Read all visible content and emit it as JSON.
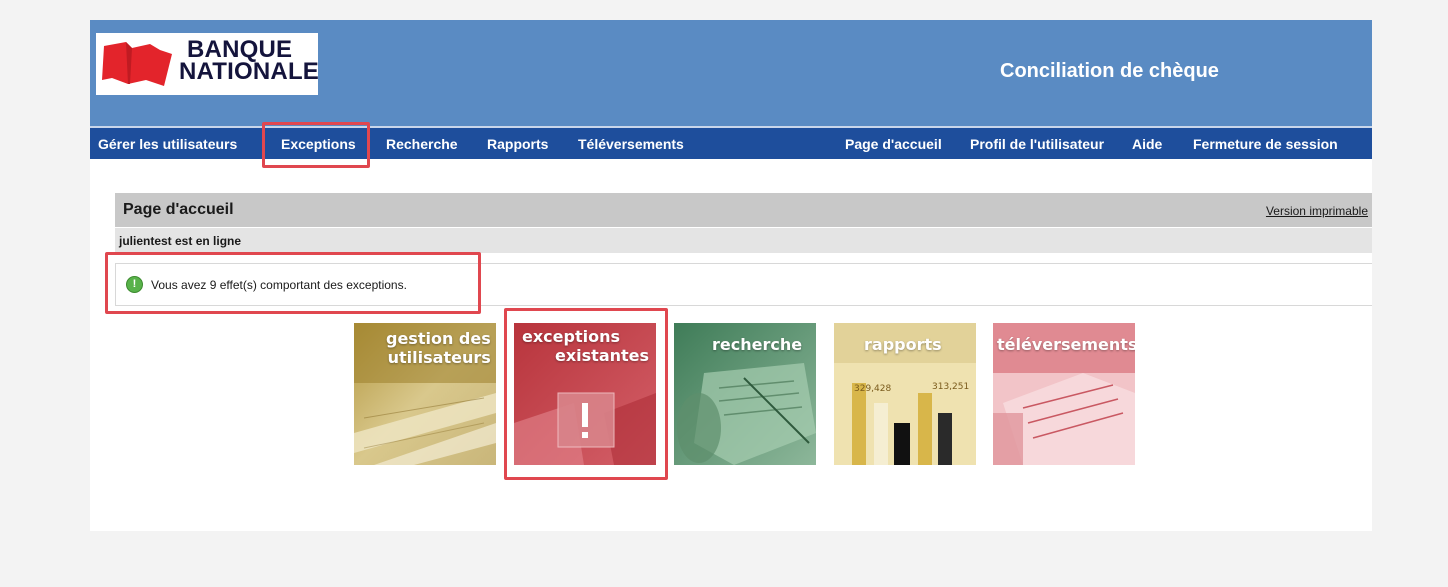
{
  "header": {
    "logo_line1": "BANQUE",
    "logo_line2": "NATIONALE",
    "app_title": "Conciliation de chèque"
  },
  "nav": {
    "left": [
      "Gérer les utilisateurs",
      "Exceptions",
      "Recherche",
      "Rapports",
      "Téléversements"
    ],
    "right": [
      "Page d'accueil",
      "Profil de l'utilisateur",
      "Aide",
      "Fermeture de session"
    ]
  },
  "page": {
    "title": "Page d'accueil",
    "print_link": "Version imprimable",
    "online_status": "julientest est en ligne",
    "message": "Vous avez 9 effet(s) comportant des exceptions."
  },
  "tiles": [
    {
      "line1": "gestion des",
      "line2": "utilisateurs"
    },
    {
      "line1": "exceptions",
      "line2": "existantes"
    },
    {
      "line1": "recherche",
      "line2": ""
    },
    {
      "line1": "rapports",
      "line2": ""
    },
    {
      "line1": "téléversements",
      "line2": ""
    }
  ],
  "colors": {
    "header_bg": "#5a8bc3",
    "nav_bg": "#1e4e9c",
    "highlight": "#e0474f",
    "logo_red": "#e3242b"
  },
  "icons": {
    "message": "info-check-icon",
    "exception_tile": "exclamation-icon"
  }
}
